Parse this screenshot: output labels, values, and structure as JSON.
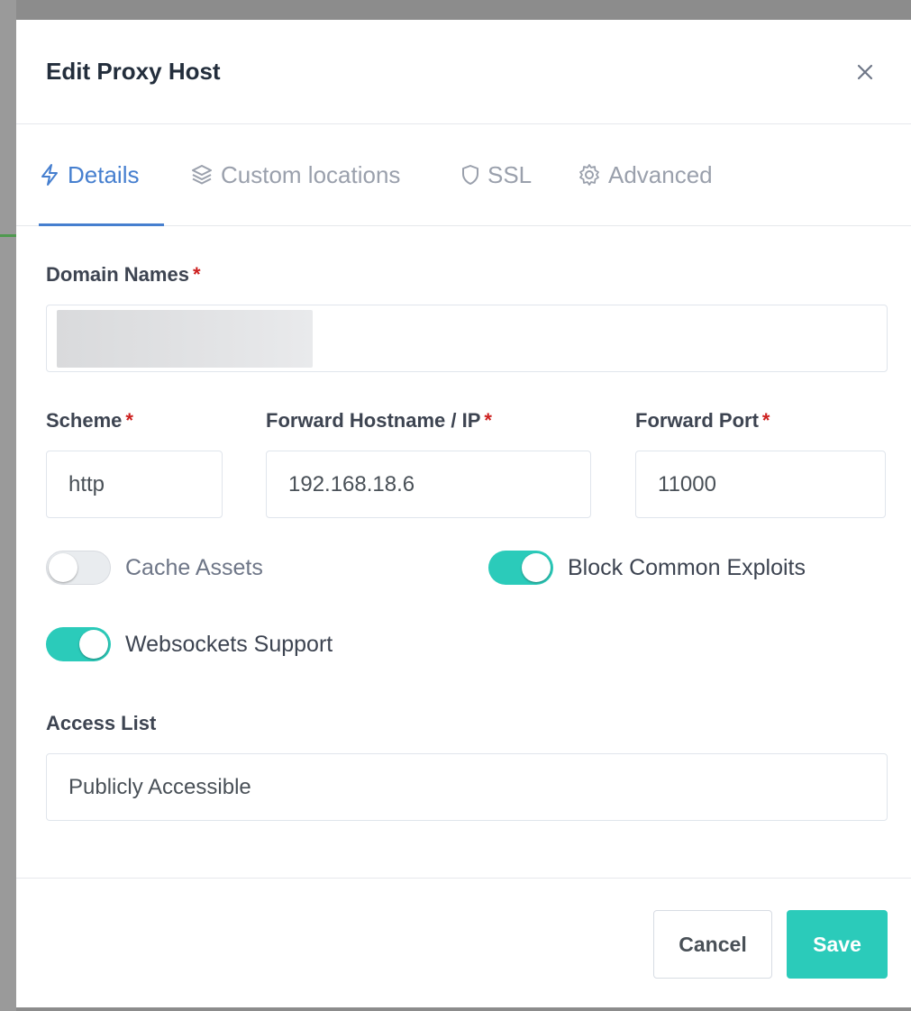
{
  "modal": {
    "title": "Edit Proxy Host",
    "close_icon": "close-icon"
  },
  "tabs": [
    {
      "label": "Details",
      "icon": "lightning-icon",
      "active": true
    },
    {
      "label": "Custom locations",
      "icon": "layers-icon",
      "active": false
    },
    {
      "label": "SSL",
      "icon": "shield-icon",
      "active": false
    },
    {
      "label": "Advanced",
      "icon": "gear-icon",
      "active": false
    }
  ],
  "form": {
    "domain_names": {
      "label": "Domain Names",
      "required_mark": "*",
      "value": ""
    },
    "scheme": {
      "label": "Scheme",
      "required_mark": "*",
      "value": "http"
    },
    "forward_hostname": {
      "label": "Forward Hostname / IP",
      "required_mark": "*",
      "value": "192.168.18.6"
    },
    "forward_port": {
      "label": "Forward Port",
      "required_mark": "*",
      "value": "11000"
    },
    "toggles": {
      "cache_assets": {
        "label": "Cache Assets",
        "enabled": false
      },
      "block_common_exploits": {
        "label": "Block Common Exploits",
        "enabled": true
      },
      "websockets_support": {
        "label": "Websockets Support",
        "enabled": true
      }
    },
    "access_list": {
      "label": "Access List",
      "value": "Publicly Accessible"
    }
  },
  "footer": {
    "cancel_label": "Cancel",
    "save_label": "Save"
  },
  "colors": {
    "accent_blue": "#467fcf",
    "teal": "#2bcbba",
    "required_red": "#cd201f",
    "title_text": "#232e3c"
  }
}
